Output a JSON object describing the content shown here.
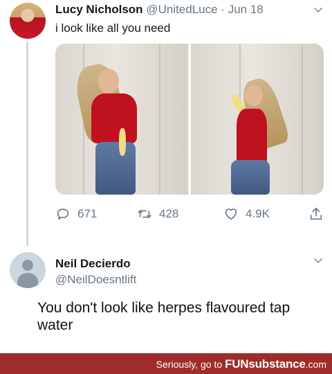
{
  "tweet": {
    "author_name": "Lucy Nicholson",
    "author_handle": "@UnitedLuce",
    "separator": "·",
    "date": "Jun 18",
    "text": "i look like all you need",
    "stats": {
      "replies": "671",
      "retweets": "428",
      "likes": "4.9K"
    }
  },
  "reply": {
    "author_name": "Neil Decierdo",
    "author_handle": "@NeilDoesntlift"
  },
  "caption": "You don't look like herpes flavoured tap water",
  "footer": {
    "prefix": "Seriously, go to",
    "brand": "FUNsubstance",
    "suffix": ".com"
  },
  "icons": {
    "reply": "speech-bubble-icon",
    "retweet": "retweet-icon",
    "like": "heart-icon",
    "share": "share-icon",
    "menu": "chevron-down-icon"
  },
  "colors": {
    "muted": "#657786",
    "thread_line": "#cfd9de",
    "footer_bg": "#9f2c2b",
    "shirt_red": "#c0111f"
  }
}
